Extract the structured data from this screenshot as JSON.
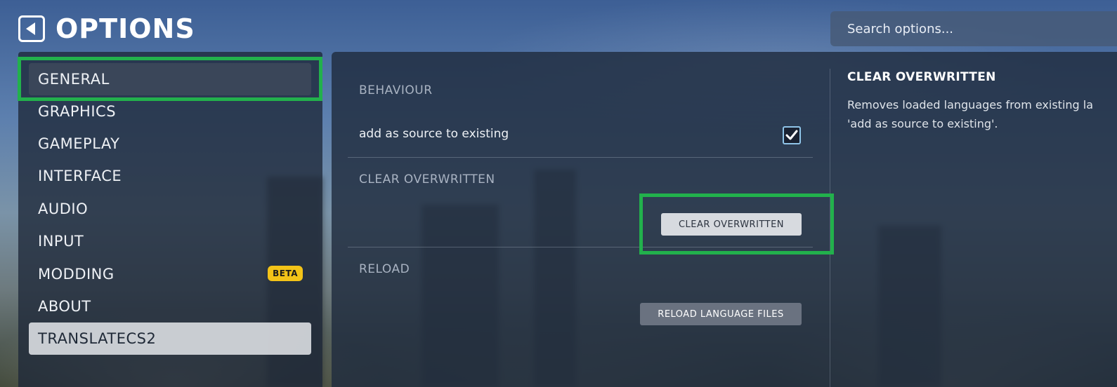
{
  "header": {
    "title": "OPTIONS",
    "back_icon": "back-arrow-icon"
  },
  "search": {
    "placeholder": "Search options..."
  },
  "sidebar": {
    "items": [
      {
        "label": "GENERAL"
      },
      {
        "label": "GRAPHICS"
      },
      {
        "label": "GAMEPLAY"
      },
      {
        "label": "INTERFACE"
      },
      {
        "label": "AUDIO"
      },
      {
        "label": "INPUT"
      },
      {
        "label": "MODDING",
        "badge": "BETA"
      },
      {
        "label": "ABOUT"
      },
      {
        "label": "TRANSLATECS2"
      }
    ]
  },
  "main": {
    "sections": {
      "behaviour": {
        "heading": "BEHAVIOUR",
        "option_label": "add as source to existing",
        "option_checked": true
      },
      "clear_overwritten": {
        "heading": "CLEAR OVERWRITTEN",
        "button_label": "CLEAR OVERWRITTEN"
      },
      "reload": {
        "heading": "RELOAD",
        "button_label": "RELOAD LANGUAGE FILES"
      }
    }
  },
  "description": {
    "title": "CLEAR OVERWRITTEN",
    "line1": "Removes loaded languages from existing la",
    "line2": "'add as source to existing'."
  },
  "colors": {
    "highlight": "#22b14c",
    "beta_badge": "#f3c318",
    "checkbox_border": "#8fc4e8"
  }
}
